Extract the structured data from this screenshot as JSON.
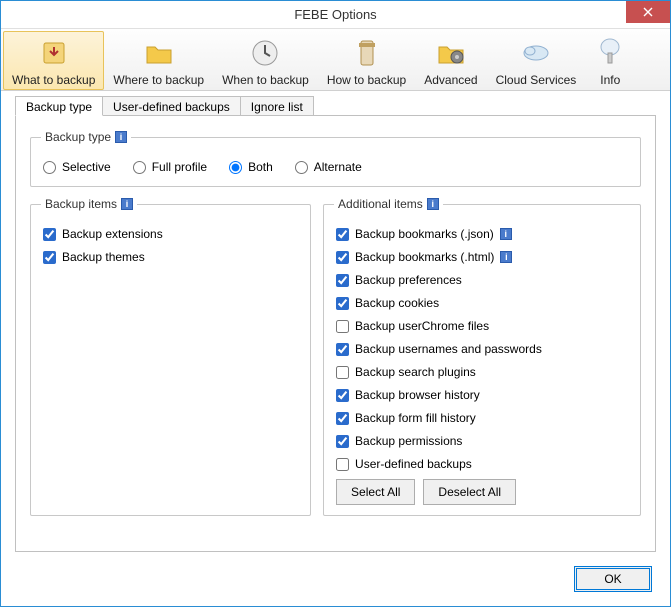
{
  "window": {
    "title": "FEBE Options"
  },
  "toolbar": [
    {
      "id": "what",
      "label": "What to backup",
      "active": true
    },
    {
      "id": "where",
      "label": "Where to backup",
      "active": false
    },
    {
      "id": "when",
      "label": "When to backup",
      "active": false
    },
    {
      "id": "how",
      "label": "How to backup",
      "active": false
    },
    {
      "id": "adv",
      "label": "Advanced",
      "active": false
    },
    {
      "id": "cloud",
      "label": "Cloud Services",
      "active": false
    },
    {
      "id": "info",
      "label": "Info",
      "active": false
    }
  ],
  "tabs": [
    {
      "label": "Backup type",
      "active": true
    },
    {
      "label": "User-defined backups",
      "active": false
    },
    {
      "label": "Ignore list",
      "active": false
    }
  ],
  "backupType": {
    "legend": "Backup type",
    "options": [
      {
        "label": "Selective",
        "checked": false
      },
      {
        "label": "Full profile",
        "checked": false
      },
      {
        "label": "Both",
        "checked": true
      },
      {
        "label": "Alternate",
        "checked": false
      }
    ]
  },
  "backupItems": {
    "legend": "Backup items",
    "items": [
      {
        "label": "Backup extensions",
        "checked": true
      },
      {
        "label": "Backup themes",
        "checked": true
      }
    ]
  },
  "additionalItems": {
    "legend": "Additional items",
    "items": [
      {
        "label": "Backup bookmarks (.json)",
        "checked": true,
        "info": true
      },
      {
        "label": "Backup bookmarks (.html)",
        "checked": true,
        "info": true
      },
      {
        "label": "Backup preferences",
        "checked": true,
        "info": false
      },
      {
        "label": "Backup cookies",
        "checked": true,
        "info": false
      },
      {
        "label": "Backup userChrome files",
        "checked": false,
        "info": false
      },
      {
        "label": "Backup usernames and passwords",
        "checked": true,
        "info": false
      },
      {
        "label": "Backup search plugins",
        "checked": false,
        "info": false
      },
      {
        "label": "Backup browser history",
        "checked": true,
        "info": false
      },
      {
        "label": "Backup form fill history",
        "checked": true,
        "info": false
      },
      {
        "label": "Backup permissions",
        "checked": true,
        "info": false
      },
      {
        "label": "User-defined backups",
        "checked": false,
        "info": false
      }
    ],
    "selectAll": "Select All",
    "deselectAll": "Deselect All"
  },
  "footer": {
    "ok": "OK"
  }
}
